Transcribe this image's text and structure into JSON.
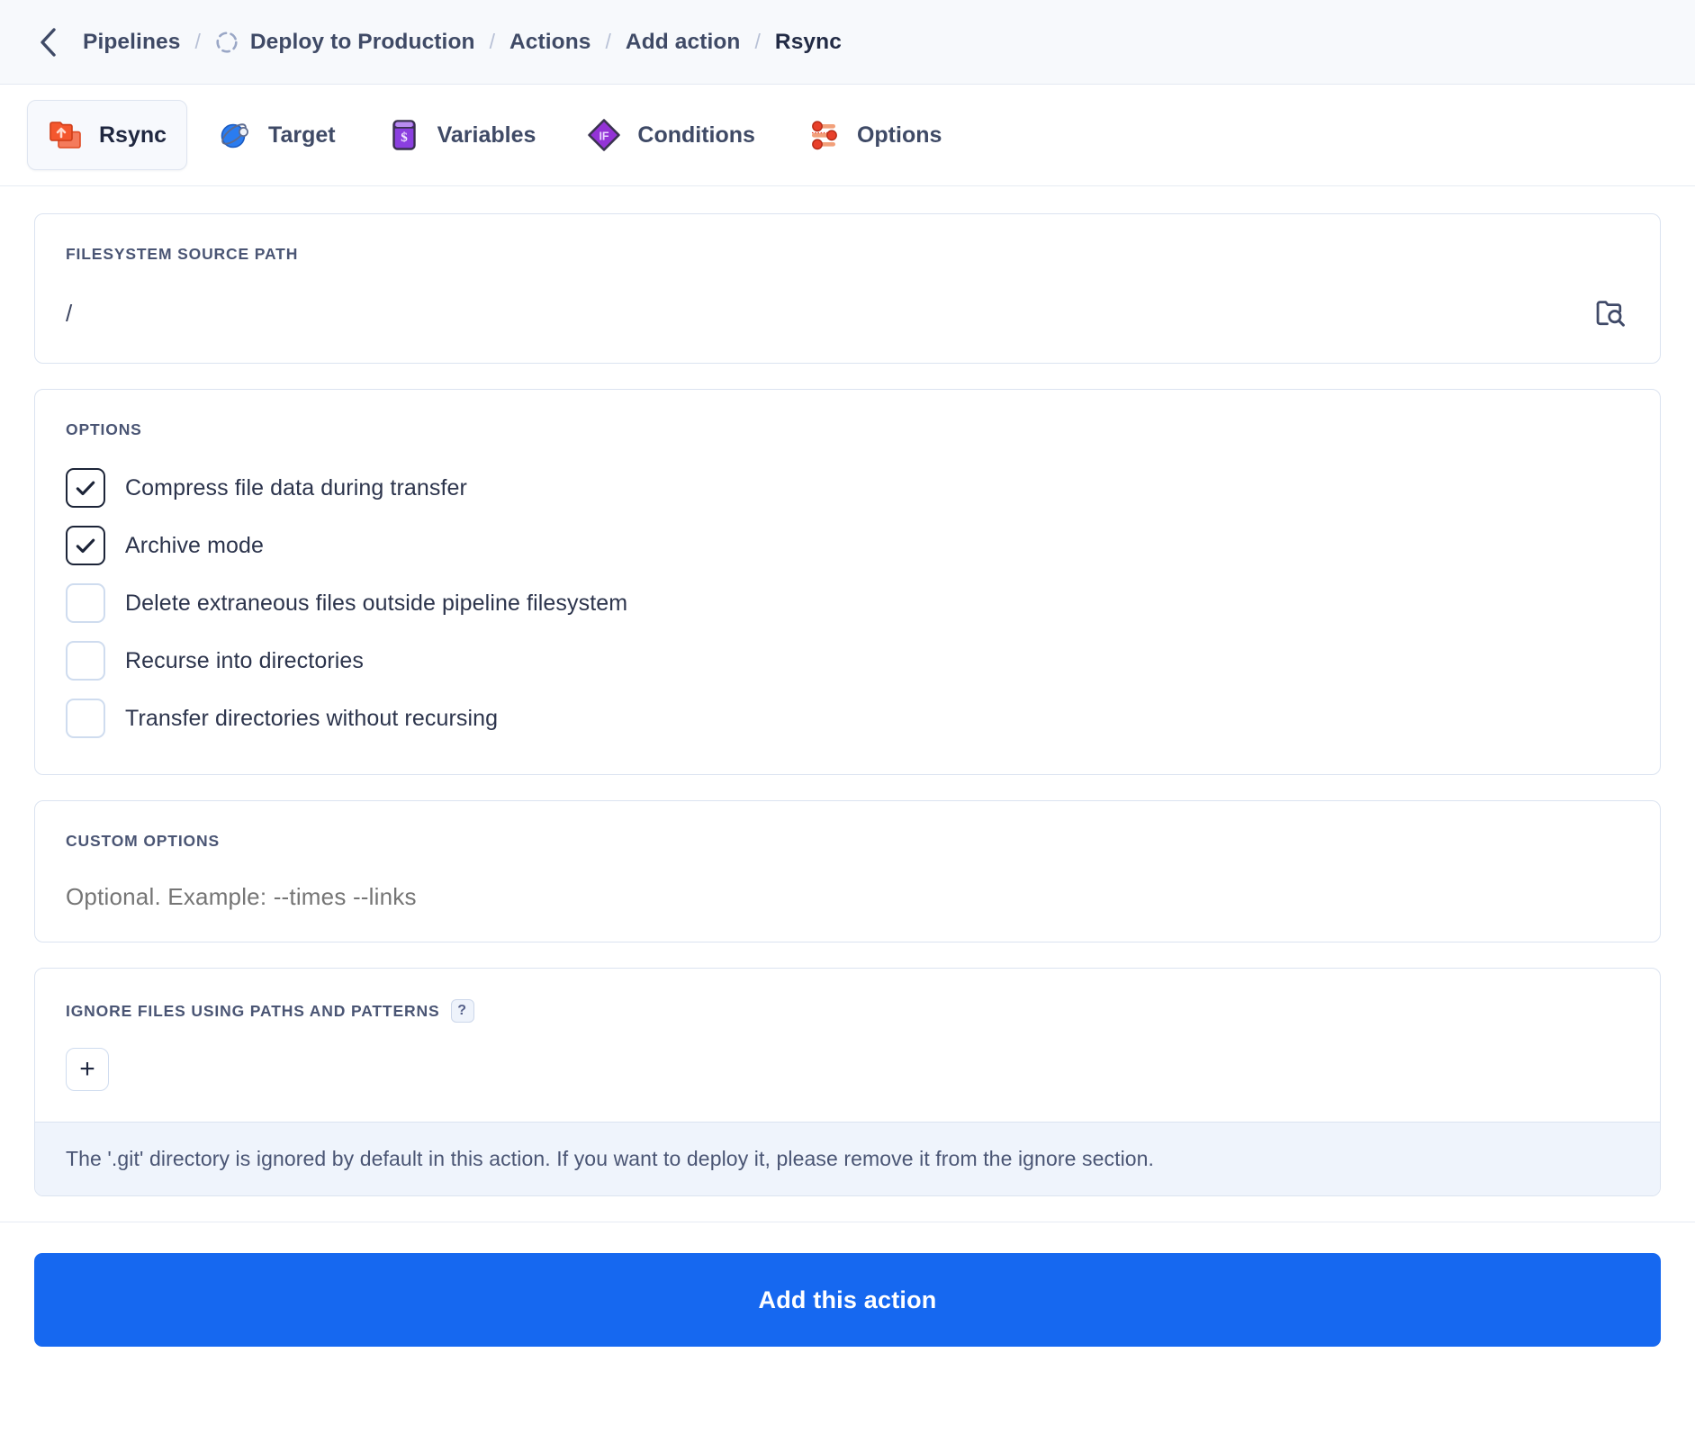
{
  "breadcrumb": {
    "back_icon": "chevron-left-icon",
    "separator": "/",
    "items": [
      {
        "label": "Pipelines",
        "icon": null,
        "current": false
      },
      {
        "label": "Deploy to Production",
        "icon": "spinner-icon",
        "current": false
      },
      {
        "label": "Actions",
        "icon": null,
        "current": false
      },
      {
        "label": "Add action",
        "icon": null,
        "current": false
      },
      {
        "label": "Rsync",
        "icon": null,
        "current": true
      }
    ]
  },
  "tabs": [
    {
      "label": "Rsync",
      "icon": "rsync-folders-icon",
      "active": true
    },
    {
      "label": "Target",
      "icon": "target-planet-icon",
      "active": false
    },
    {
      "label": "Variables",
      "icon": "variables-dollar-icon",
      "active": false
    },
    {
      "label": "Conditions",
      "icon": "conditions-if-diamond-icon",
      "active": false
    },
    {
      "label": "Options",
      "icon": "options-sliders-icon",
      "active": false
    }
  ],
  "source_path": {
    "label": "FILESYSTEM SOURCE PATH",
    "value": "/",
    "placeholder": "/",
    "browse_icon": "folder-search-icon"
  },
  "options": {
    "label": "OPTIONS",
    "items": [
      {
        "label": "Compress file data during transfer",
        "checked": true
      },
      {
        "label": "Archive mode",
        "checked": true
      },
      {
        "label": "Delete extraneous files outside pipeline filesystem",
        "checked": false
      },
      {
        "label": "Recurse into directories",
        "checked": false
      },
      {
        "label": "Transfer directories without recursing",
        "checked": false
      }
    ]
  },
  "custom_options": {
    "label": "CUSTOM OPTIONS",
    "value": "",
    "placeholder": "Optional. Example: --times --links"
  },
  "ignore_files": {
    "label": "IGNORE FILES USING PATHS AND PATTERNS",
    "help_badge": "?",
    "add_button": "+",
    "note": "The '.git' directory is ignored by default in this action. If you want to deploy it, please remove it from the ignore section."
  },
  "footer": {
    "submit_label": "Add this action"
  },
  "colors": {
    "accent_blue": "#1668f0",
    "breadcrumb_bg": "#f7f9fc",
    "text_dark": "#222b45",
    "text_muted": "#97a2bd",
    "border": "#dbe3f0",
    "note_bg": "#eff4fc",
    "rsync_icon": "#f4572e",
    "target_icon": "#2a7cf0",
    "variables_icon": "#8b3fe0",
    "conditions_icon": "#9333d6",
    "options_icon": "#e8402a"
  }
}
